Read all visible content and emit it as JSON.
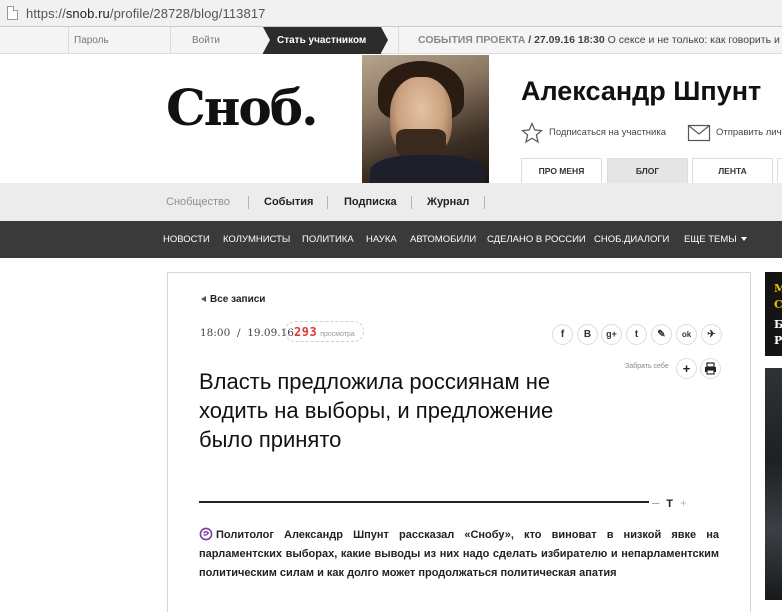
{
  "browser": {
    "url_scheme": "https://",
    "url_host": "snob.ru",
    "url_path": "/profile/28728/blog/113817"
  },
  "topbar": {
    "password_label": "Пароль",
    "login_label": "Войти",
    "join_label": "Стать участником",
    "events_label": "СОБЫТИЯ ПРОЕКТА",
    "events_date": "/ 27.09.16 18:30",
    "events_text": "О сексе и не только: как говорить и с чего"
  },
  "header": {
    "logo": "Сноб.",
    "author_name": "Александр Шпунт",
    "subscribe_label": "Подписаться на участника",
    "send_message_label": "Отправить личн",
    "tabs": [
      "ПРО МЕНЯ",
      "БЛОГ",
      "ЛЕНТА"
    ]
  },
  "community_nav": {
    "items": [
      "Снобщество",
      "События",
      "Подписка",
      "Журнал"
    ]
  },
  "main_nav": {
    "items": [
      "НОВОСТИ",
      "КОЛУМНИСТЫ",
      "ПОЛИТИКА",
      "НАУКА",
      "АВТОМОБИЛИ",
      "СДЕЛАНО В РОССИИ",
      "СНОБ.ДИАЛОГИ",
      "ЕЩЕ ТЕМЫ"
    ]
  },
  "article": {
    "back_label": "Все записи",
    "time": "18:00",
    "date_sep": "/",
    "date": "19.09.16",
    "views_count": "293",
    "views_label": "просмотра",
    "share_icons": [
      "f",
      "В",
      "g+",
      "t",
      "✎",
      "ok",
      "✈"
    ],
    "save_label": "Забрать себе",
    "title": "Власть предложила россиянам не ходить на выборы, и предложение было принято",
    "font_minus": "–",
    "font_t": "Т",
    "font_plus": "+",
    "lead": "Политолог Александр Шпунт рассказал «Снобу», кто виноват в низкой явке на парламентских выборах, какие выводы из них надо сделать избирателю и непарламентским политическим силам и как долго может продолжаться политическая апатия"
  },
  "sidebar": {
    "letters_top": [
      "М",
      "С"
    ],
    "letters_bottom": [
      "Б",
      "Р"
    ]
  },
  "colors": {
    "dark_nav": "#3a3a3a",
    "views_red": "#e03a3a",
    "snob_purple": "#7b3fa0"
  }
}
